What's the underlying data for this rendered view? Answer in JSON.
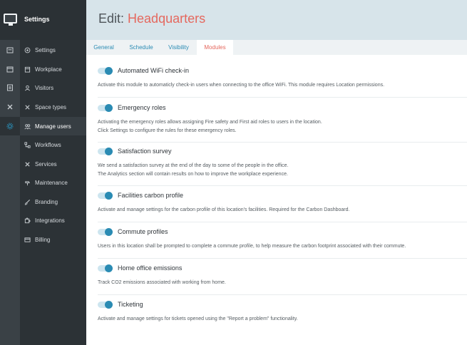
{
  "app": {
    "title": "Settings"
  },
  "rail_icons": [
    "building-icon",
    "calendar-icon",
    "id-card-icon",
    "tools-icon",
    "gear-icon"
  ],
  "nav": [
    {
      "label": "Settings",
      "icon": "gear-icon",
      "active": false
    },
    {
      "label": "Workplace",
      "icon": "building-icon",
      "active": false
    },
    {
      "label": "Visitors",
      "icon": "people-icon",
      "active": false
    },
    {
      "label": "Space types",
      "icon": "tools-icon",
      "active": false
    },
    {
      "label": "Manage users",
      "icon": "users-icon",
      "active": true
    },
    {
      "label": "Workflows",
      "icon": "flow-icon",
      "active": false
    },
    {
      "label": "Services",
      "icon": "wrench-icon",
      "active": false
    },
    {
      "label": "Maintenance",
      "icon": "hammer-icon",
      "active": false
    },
    {
      "label": "Branding",
      "icon": "brush-icon",
      "active": false
    },
    {
      "label": "Integrations",
      "icon": "puzzle-icon",
      "active": false
    },
    {
      "label": "Billing",
      "icon": "card-icon",
      "active": false
    }
  ],
  "header": {
    "prefix": "Edit:",
    "name": "Headquarters"
  },
  "tabs": [
    {
      "label": "General",
      "active": false
    },
    {
      "label": "Schedule",
      "active": false
    },
    {
      "label": "Visibility",
      "active": false
    },
    {
      "label": "Modules",
      "active": true
    }
  ],
  "modules": [
    {
      "title": "Automated WiFi check-in",
      "enabled": true,
      "description": [
        "Activate this module to automaticly check-in users when connecting to the office WiFi. This module requires Location permissions."
      ]
    },
    {
      "title": "Emergency roles",
      "enabled": true,
      "description": [
        "Activating the emergency roles allows assigning Fire safety and First aid roles to users in the location.",
        "Click Settings to configure the rules for these emergency roles."
      ]
    },
    {
      "title": "Satisfaction survey",
      "enabled": true,
      "description": [
        "We send a satisfaction survey at the end of the day to some of the people in the office.",
        "The Analytics section will contain results on how to improve the workplace experience."
      ]
    },
    {
      "title": "Facilities carbon profile",
      "enabled": true,
      "description": [
        "Activate and manage settings for the carbon profile of this location's facilities. Required for the Carbon Dashboard."
      ]
    },
    {
      "title": "Commute profiles",
      "enabled": true,
      "description": [
        "Users in this location shall be prompted to complete a commute profile, to help measure the carbon footprint associated with their commute."
      ]
    },
    {
      "title": "Home office emissions",
      "enabled": true,
      "description": [
        "Track CO2 emissions associated with working from home."
      ]
    },
    {
      "title": "Ticketing",
      "enabled": true,
      "description": [
        "Activate and manage settings for tickets opened using the \"Report a problem\" functionality."
      ]
    }
  ],
  "colors": {
    "accent": "#2a8bb3",
    "title_accent": "#e5685e",
    "sidebar": "#2c3236",
    "header_bg": "#d7e4ea"
  }
}
